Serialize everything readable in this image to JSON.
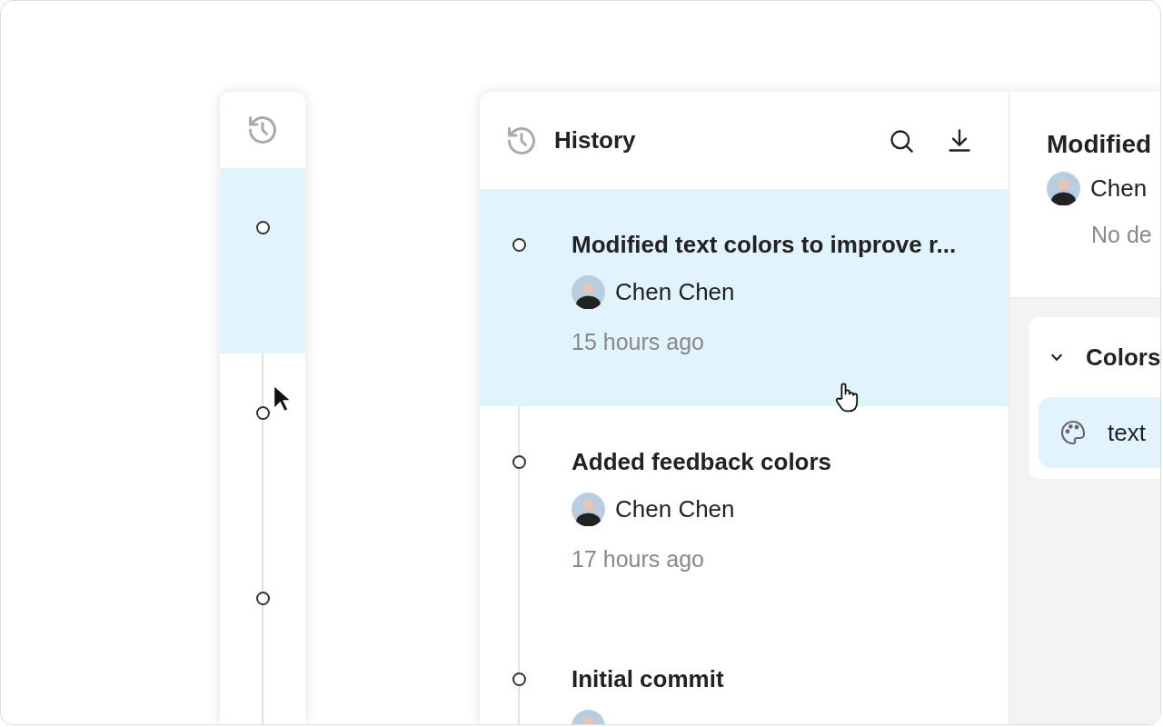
{
  "rail": {
    "commits": [
      {
        "selected": true
      },
      {
        "selected": false
      },
      {
        "selected": false
      }
    ]
  },
  "history": {
    "title": "History",
    "commits": [
      {
        "title": "Modified text colors to improve r...",
        "author": "Chen Chen",
        "time": "15 hours ago",
        "selected": true
      },
      {
        "title": "Added feedback colors",
        "author": "Chen Chen",
        "time": "17 hours ago",
        "selected": false
      },
      {
        "title": "Initial commit",
        "selected": false
      }
    ]
  },
  "detail": {
    "title": "Modified",
    "author": "Chen",
    "description": "No de",
    "group": {
      "title": "Colors",
      "expanded": true,
      "items": [
        {
          "name": "text",
          "selected": true
        }
      ]
    }
  }
}
